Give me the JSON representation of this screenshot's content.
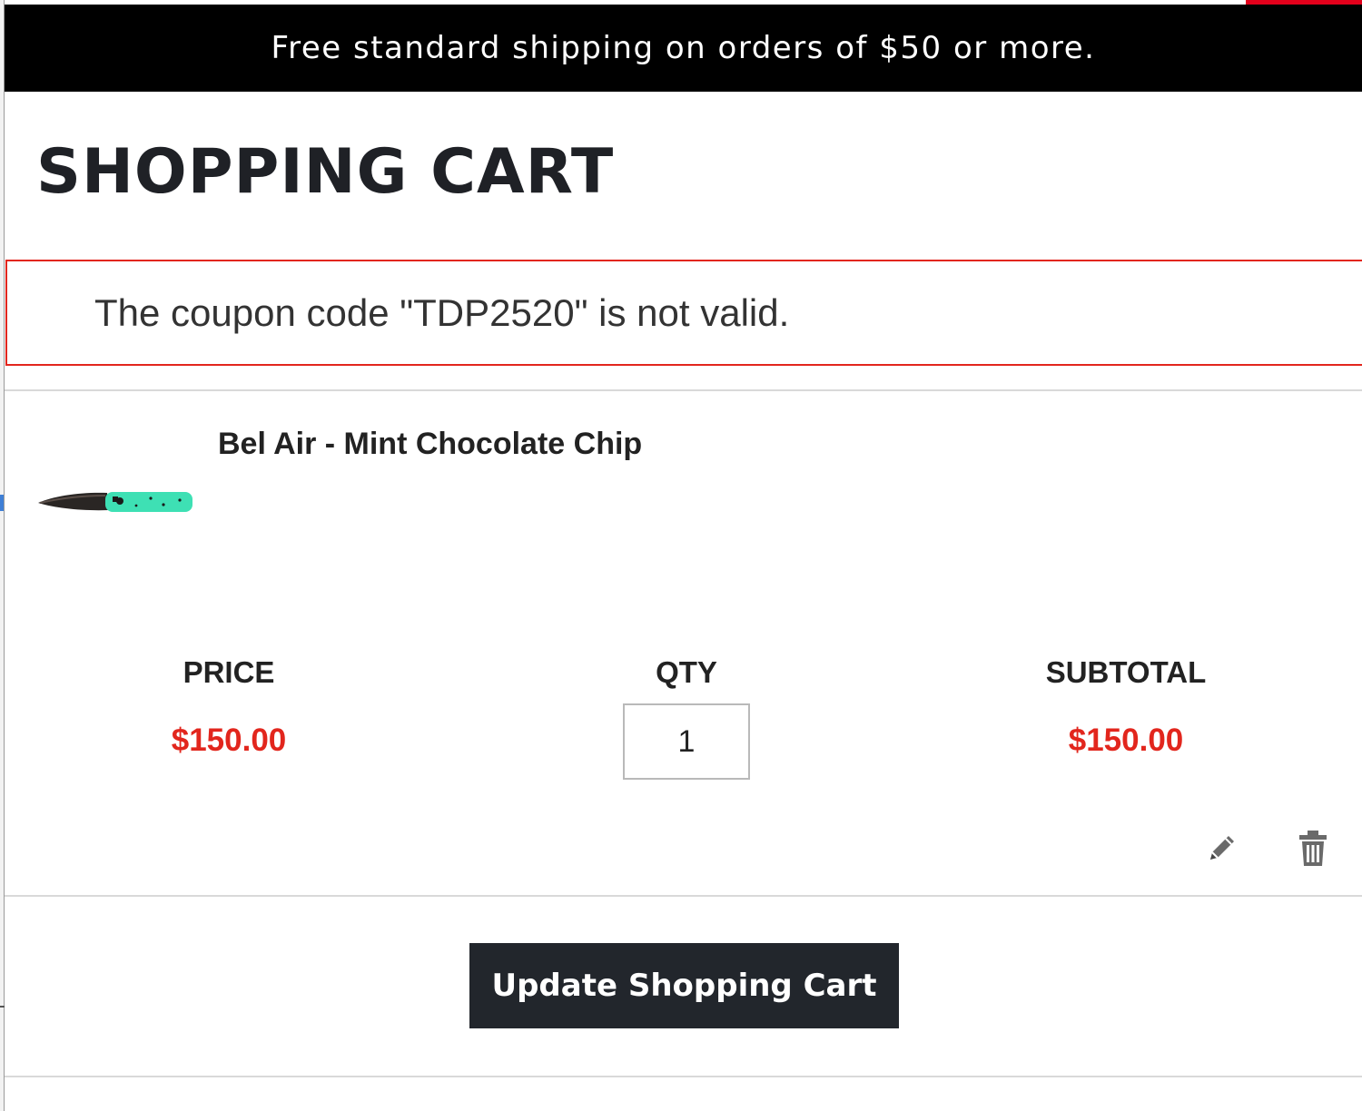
{
  "banner": {
    "text": "Free standard shipping on orders of $50 or more."
  },
  "page": {
    "title": "SHOPPING CART"
  },
  "alert": {
    "message": "The coupon code \"TDP2520\" is not valid."
  },
  "cart": {
    "items": [
      {
        "name": "Bel Air - Mint Chocolate Chip",
        "image_icon": "knife-product-image",
        "price": "$150.00",
        "qty": "1",
        "subtotal": "$150.00"
      }
    ],
    "columns": {
      "price": "PRICE",
      "qty": "QTY",
      "subtotal": "SUBTOTAL"
    },
    "actions": {
      "edit_icon": "pencil-icon",
      "delete_icon": "trash-icon"
    },
    "update_label": "Update Shopping Cart"
  },
  "colors": {
    "banner_bg": "#000000",
    "accent_red": "#e2261d",
    "button_bg": "#22262c",
    "knife_handle": "#3ee0b4"
  }
}
